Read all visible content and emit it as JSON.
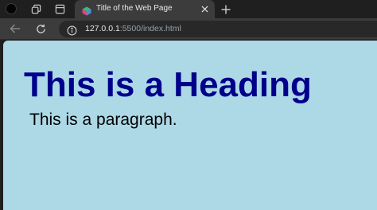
{
  "browser": {
    "tab": {
      "title": "Title of the Web Page"
    },
    "address_bar": {
      "url_host": "127.0.0.1",
      "url_rest": ":5500/index.html"
    },
    "icons": [
      "profile-avatar",
      "workspaces-icon",
      "tab-actions-icon",
      "favicon-icon",
      "close-icon",
      "plus-icon",
      "back-arrow-icon",
      "reload-icon",
      "info-icon"
    ]
  },
  "page": {
    "heading": "This is a Heading",
    "paragraph": "This is a paragraph.",
    "background_color": "#add8e6",
    "heading_color": "#00008b"
  }
}
